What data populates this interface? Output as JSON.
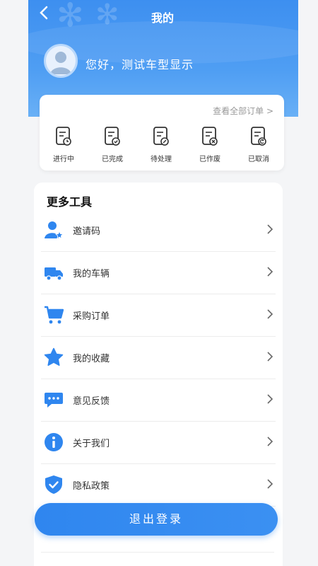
{
  "header": {
    "title": "我的",
    "greeting": "您好，测试车型显示"
  },
  "orders": {
    "view_all": "查看全部订单 >",
    "items": [
      {
        "label": "进行中",
        "icon": "doc-clock-icon"
      },
      {
        "label": "已完成",
        "icon": "doc-check-icon"
      },
      {
        "label": "待处理",
        "icon": "doc-pen-icon"
      },
      {
        "label": "已作废",
        "icon": "doc-x-icon"
      },
      {
        "label": "已取消",
        "icon": "doc-back-icon"
      }
    ]
  },
  "tools": {
    "title": "更多工具",
    "items": [
      {
        "label": "邀请码",
        "icon": "user-star-icon"
      },
      {
        "label": "我的车辆",
        "icon": "truck-icon"
      },
      {
        "label": "采购订单",
        "icon": "cart-icon"
      },
      {
        "label": "我的收藏",
        "icon": "star-icon"
      },
      {
        "label": "意见反馈",
        "icon": "chat-icon"
      },
      {
        "label": "关于我们",
        "icon": "info-icon"
      },
      {
        "label": "隐私政策",
        "icon": "shield-icon"
      }
    ]
  },
  "logout_label": "退出登录",
  "colors": {
    "primary": "#2f86ef",
    "header": "#4f9ef3"
  }
}
